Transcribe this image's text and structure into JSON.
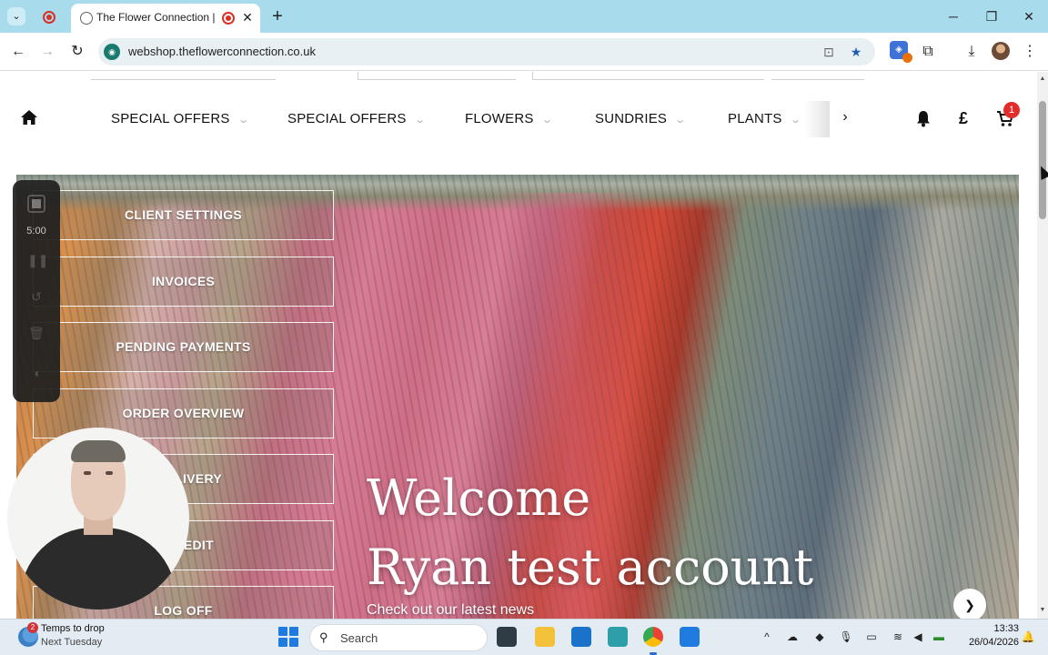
{
  "browser": {
    "tab_title": "The Flower Connection | We",
    "url": "webshop.theflowerconnection.co.uk"
  },
  "site": {
    "nav": {
      "items": [
        {
          "label": "SPECIAL OFFERS"
        },
        {
          "label": "SPECIAL OFFERS"
        },
        {
          "label": "FLOWERS"
        },
        {
          "label": "SUNDRIES"
        },
        {
          "label": "PLANTS"
        }
      ],
      "currency_symbol": "£",
      "cart_count": "1"
    },
    "account_menu": [
      {
        "label": "CLIENT SETTINGS"
      },
      {
        "label": "INVOICES"
      },
      {
        "label": "PENDING PAYMENTS"
      },
      {
        "label": "ORDER OVERVIEW"
      },
      {
        "label": "F DELIVERY"
      },
      {
        "label": "T CREDIT"
      },
      {
        "label": "LOG OFF"
      }
    ],
    "hero": {
      "welcome_line1": "Welcome",
      "welcome_line2": "Ryan test account",
      "news_text": "Check out our latest news"
    }
  },
  "recorder": {
    "time": "5:00"
  },
  "taskbar": {
    "weather_badge": "2",
    "weather_title": "Temps to drop",
    "weather_subtitle": "Next Tuesday",
    "search_placeholder": "Search",
    "time": "13:33",
    "date": "26/04/2026"
  },
  "colors": {
    "tabstrip": "#a8dcec",
    "cart_badge": "#e32b2b",
    "accent": "#1a7a6e"
  }
}
